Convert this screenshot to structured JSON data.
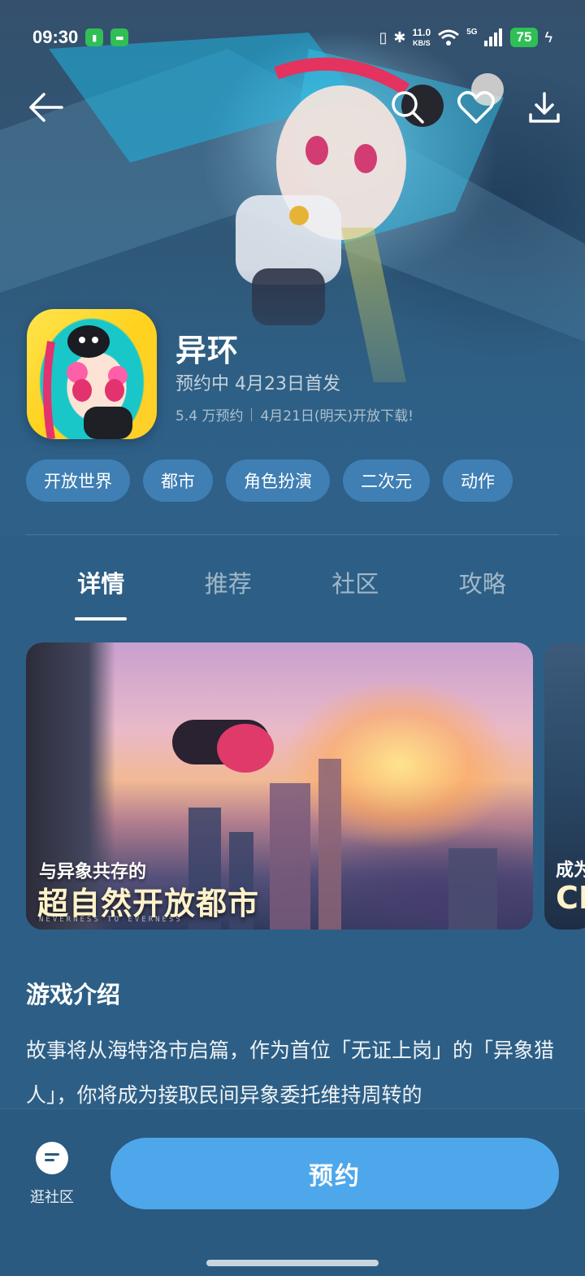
{
  "status_bar": {
    "time": "09:30",
    "net_speed_value": "11.0",
    "net_speed_unit": "KB/S",
    "network_label": "5G",
    "battery": "75"
  },
  "nav": {
    "back_icon": "arrow-left-icon",
    "search_icon": "search-icon",
    "favorite_icon": "heart-icon",
    "download_icon": "download-icon"
  },
  "game": {
    "title": "异环",
    "status": "预约中 4月23日首发",
    "reservations": "5.4 万预约",
    "download_notice": "4月21日(明天)开放下载!"
  },
  "tags": [
    "开放世界",
    "都市",
    "角色扮演",
    "二次元",
    "动作"
  ],
  "tabs": [
    {
      "label": "详情",
      "active": true
    },
    {
      "label": "推荐",
      "active": false
    },
    {
      "label": "社区",
      "active": false
    },
    {
      "label": "攻略",
      "active": false
    }
  ],
  "screenshots": [
    {
      "caption_small": "与异象共存的",
      "caption_big": "超自然开放都市",
      "caption_tiny": "NEVERNESS TO EVERNESS"
    },
    {
      "caption_small": "成为",
      "caption_big": "CI"
    }
  ],
  "intro": {
    "title": "游戏介绍",
    "text": "故事将从海特洛市启篇，作为首位「无证上岗」的「异象猎人」，你将成为接取民间异象委托维持周转的"
  },
  "bottom": {
    "community_label": "逛社区",
    "reserve_label": "预约"
  },
  "colors": {
    "background": "#2d5f86",
    "tag_bg": "#3f7fb4",
    "reserve_button": "#4ea7ea",
    "battery": "#2fbf55"
  }
}
